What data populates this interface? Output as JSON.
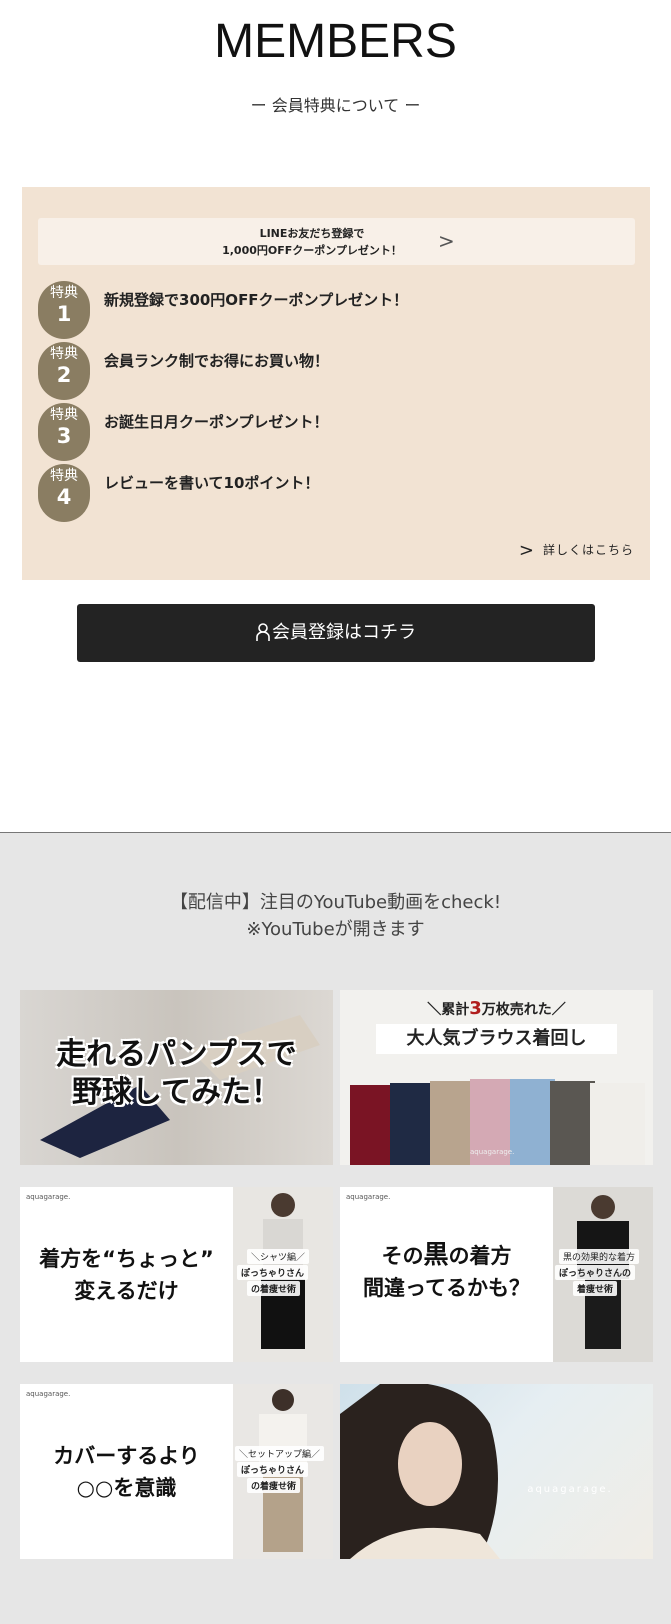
{
  "members": {
    "title": "MEMBERS",
    "subtitle": "ー 会員特典について ー",
    "line_banner": {
      "line1": "LINEお友だち登録で",
      "line2": "1,000円OFFクーポンプレゼント！",
      "arrow": ">"
    },
    "benefits": [
      {
        "badge": "特典",
        "num": "1",
        "text": "新規登録で300円OFFクーポンプレゼント！"
      },
      {
        "badge": "特典",
        "num": "2",
        "text": "会員ランク制でお得にお買い物！"
      },
      {
        "badge": "特典",
        "num": "3",
        "text": "お誕生日月クーポンプレゼント！"
      },
      {
        "badge": "特典",
        "num": "4",
        "text": "レビューを書いて10ポイント！"
      }
    ],
    "details": {
      "arrow": ">",
      "label": "詳しくはこちら"
    },
    "register_label": "会員登録はコチラ"
  },
  "youtube": {
    "heading_line1": "【配信中】注目のYouTube動画をcheck!",
    "heading_line2": "※YouTubeが開きます",
    "thumbs": [
      {
        "text1": "走れるパンプスで",
        "text2": "野球してみた！"
      },
      {
        "pre": "＼累計",
        "big": "3",
        "post": "万枚売れた／",
        "text": "大人気ブラウス着回し",
        "brand": "aquagarage."
      },
      {
        "brand": "aquagarage.",
        "text1": "着方を“ちょっと”",
        "text2": "変えるだけ",
        "tag1": "＼シャツ編／",
        "tag2": "ぽっちゃりさん",
        "tag3": "の着痩せ術"
      },
      {
        "brand": "aquagarage.",
        "pre": "その",
        "big": "黒",
        "post": "の着方",
        "text2": "間違ってるかも？",
        "tag1": "黒の効果的な着方",
        "tag2": "ぽっちゃりさんの",
        "tag3": "着痩せ術"
      },
      {
        "brand": "aquagarage.",
        "text1": "カバーするより",
        "text2": "○○を意識",
        "tag1": "＼セットアップ編／",
        "tag2": "ぽっちゃりさん",
        "tag3": "の着痩せ術"
      },
      {
        "brand": "aquagarage."
      }
    ]
  }
}
